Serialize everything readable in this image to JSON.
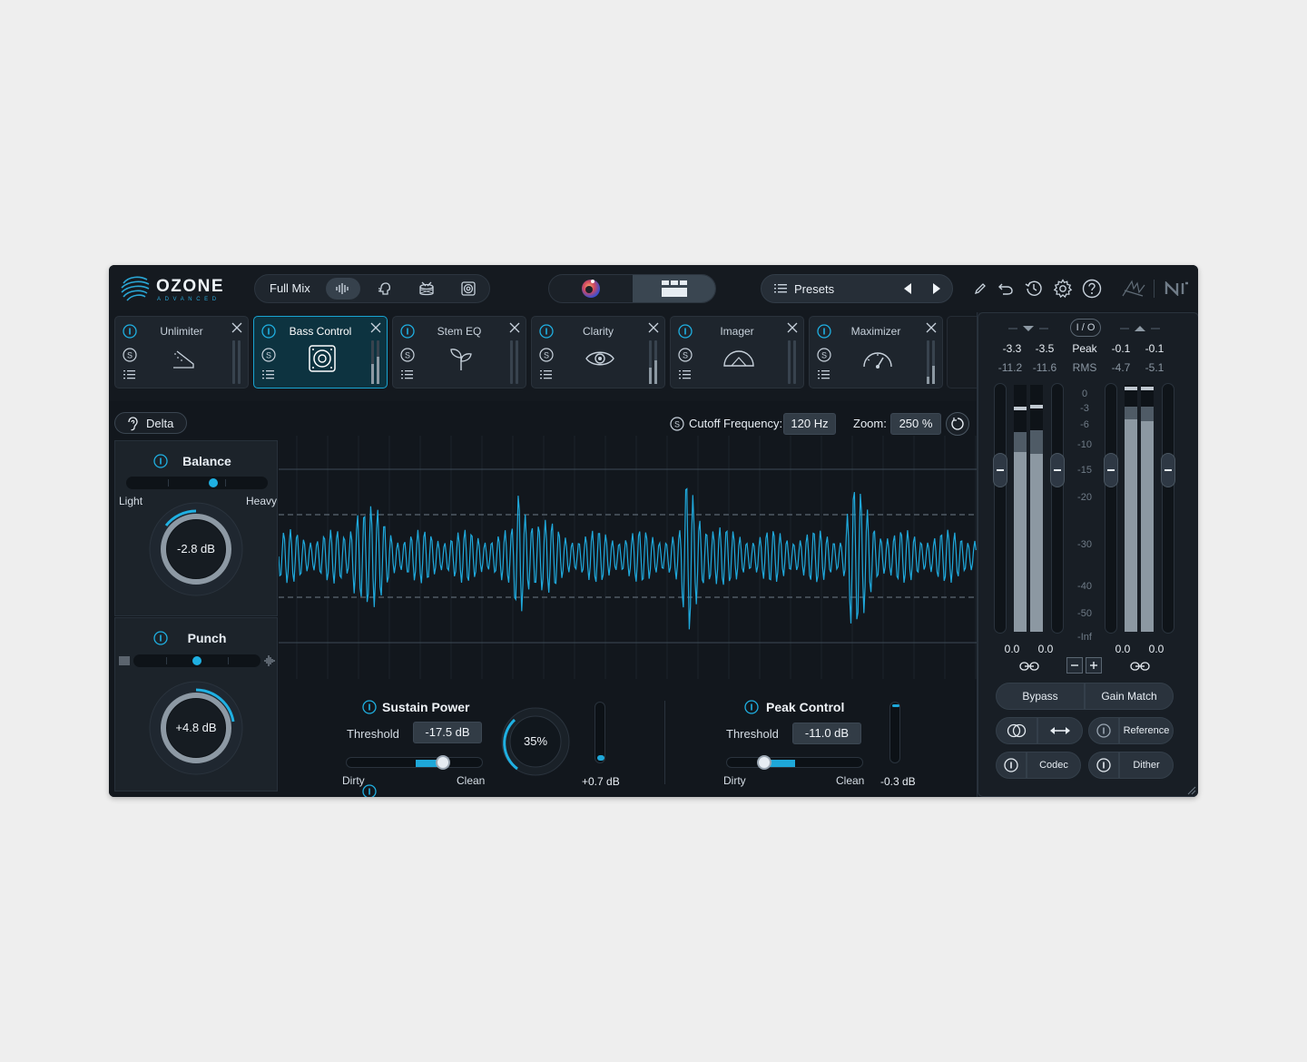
{
  "app": {
    "logo_name": "OZONE",
    "logo_sub": "ADVANCED",
    "mix_mode": "Full Mix",
    "mode_icons": [
      "waveform-icon",
      "vocal-icon",
      "drums-icon",
      "bass-speaker-icon"
    ],
    "presets_label": "Presets",
    "tools": [
      "pencil-icon",
      "undo-icon",
      "history-icon",
      "gear-icon",
      "help-icon",
      "ozone-signature-icon",
      "ni-logo-icon"
    ],
    "accent_color": "#1fb0e2"
  },
  "modules": [
    {
      "name": "Unlimiter",
      "icon": "unlimiter-icon",
      "active": false
    },
    {
      "name": "Bass Control",
      "icon": "speaker-icon",
      "active": true
    },
    {
      "name": "Stem EQ",
      "icon": "sprout-icon",
      "active": false
    },
    {
      "name": "Clarity",
      "icon": "eye-icon",
      "active": false
    },
    {
      "name": "Imager",
      "icon": "imager-icon",
      "active": false
    },
    {
      "name": "Maximizer",
      "icon": "gauge-icon",
      "active": false
    }
  ],
  "editor": {
    "delta_label": "Delta",
    "cutoff_label": "Cutoff Frequency:",
    "cutoff_value": "120 Hz",
    "zoom_label": "Zoom:",
    "zoom_value": "250 %",
    "balance": {
      "title": "Balance",
      "left_label": "Light",
      "right_label": "Heavy",
      "position": 0.62,
      "knob_value": "-2.8 dB"
    },
    "punch": {
      "title": "Punch",
      "position": 0.5,
      "knob_value": "+4.8 dB"
    },
    "sustain_power": {
      "title": "Sustain Power",
      "threshold_label": "Threshold",
      "threshold_value": "-17.5 dB",
      "left_label": "Dirty",
      "right_label": "Clean",
      "slider_value": 0.7,
      "amount": "35%",
      "gain": "+0.7 dB"
    },
    "peak_control": {
      "title": "Peak Control",
      "threshold_label": "Threshold",
      "threshold_value": "-11.0 dB",
      "left_label": "Dirty",
      "right_label": "Clean",
      "slider_value": 0.27,
      "gain": "-0.3 dB"
    }
  },
  "meters": {
    "io_label": "I / O",
    "peak_label": "Peak",
    "rms_label": "RMS",
    "input_peak": [
      "-3.3",
      "-3.5"
    ],
    "input_rms": [
      "-11.2",
      "-11.6"
    ],
    "output_peak": [
      "-0.1",
      "-0.1"
    ],
    "output_rms": [
      "-4.7",
      "-5.1"
    ],
    "scale": [
      "0",
      "-3",
      "-6",
      "-10",
      "-15",
      "-20",
      "-30",
      "-40",
      "-50",
      "-Inf"
    ],
    "input_gain": [
      "0.0",
      "0.0"
    ],
    "output_gain": [
      "0.0",
      "0.0"
    ]
  },
  "buttons": {
    "bypass": "Bypass",
    "gain_match": "Gain Match",
    "reference": "Reference",
    "codec": "Codec",
    "dither": "Dither"
  }
}
